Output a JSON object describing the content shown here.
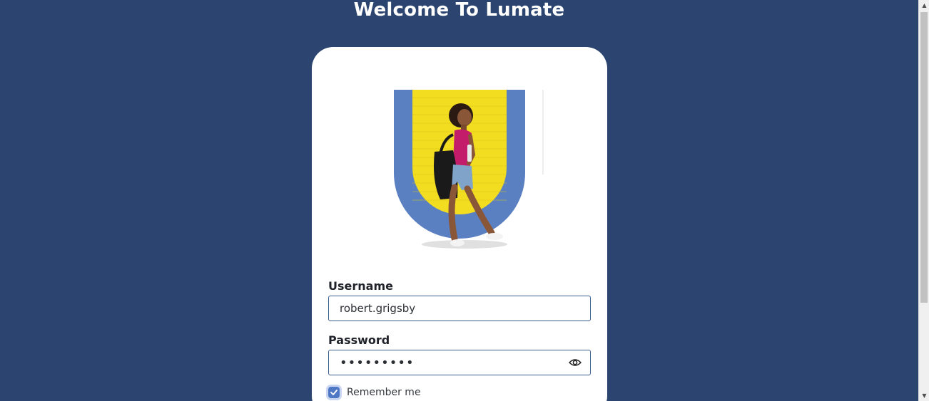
{
  "page": {
    "title": "Welcome To Lumate"
  },
  "login": {
    "username_label": "Username",
    "username_value": "robert.grigsby",
    "password_label": "Password",
    "password_value": "•••••••••",
    "remember_label": "Remember me",
    "remember_checked": true,
    "show_password_icon": "eye-icon"
  },
  "colors": {
    "background": "#2b4470",
    "card": "#ffffff",
    "accent": "#4f78c4",
    "logo_blue": "#5b80c2",
    "logo_yellow": "#f2dd21"
  }
}
